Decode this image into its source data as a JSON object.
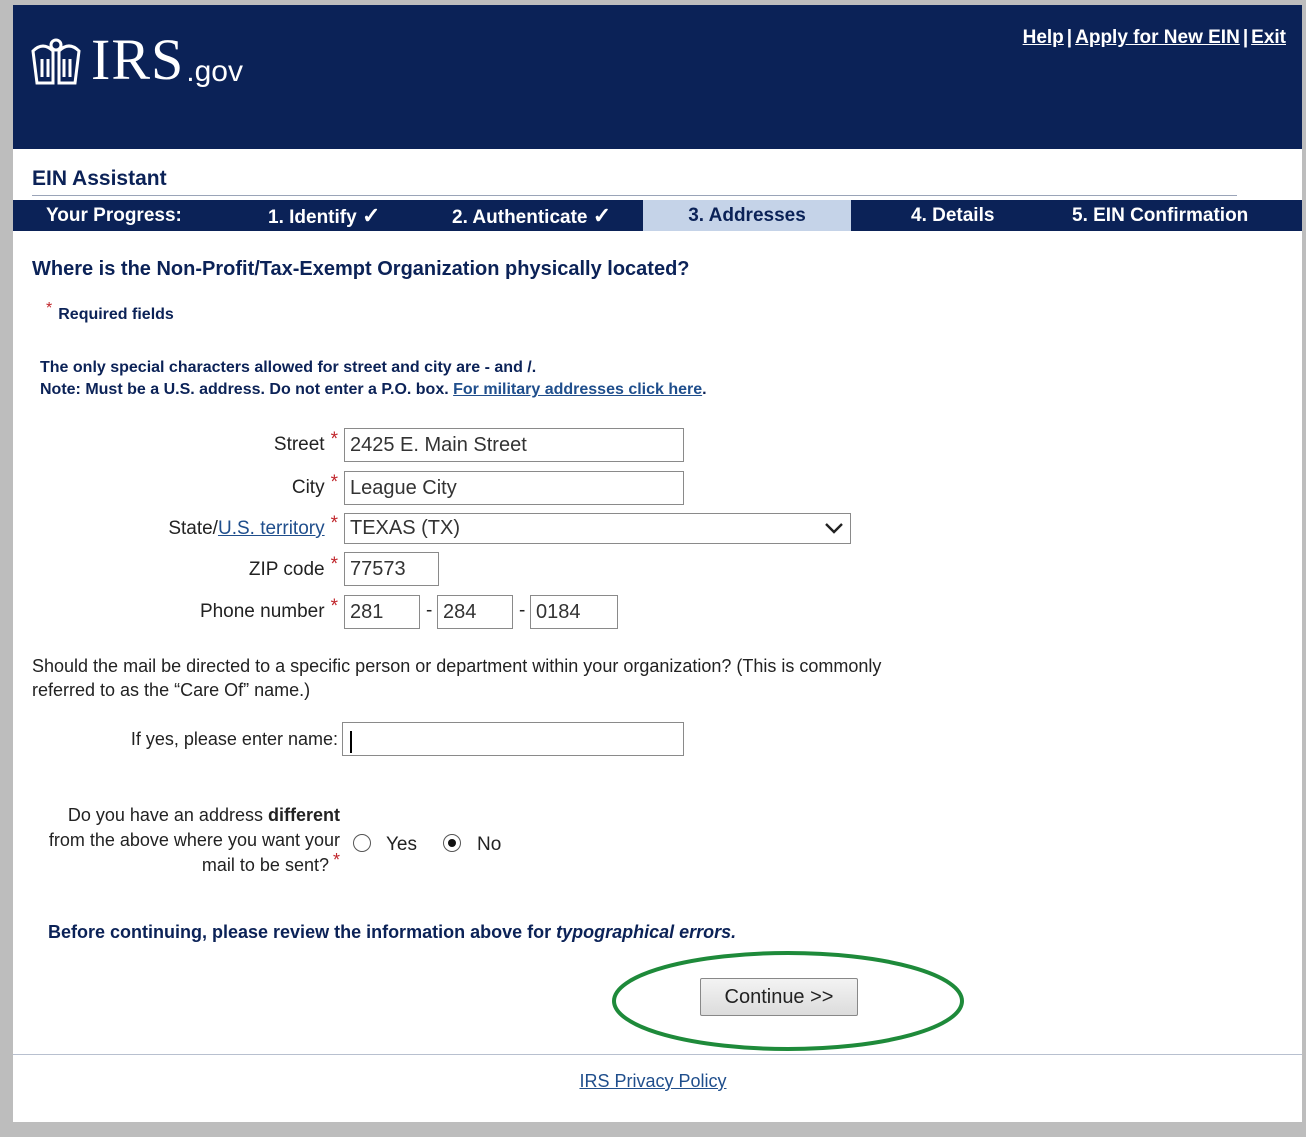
{
  "header": {
    "logo_text": "IRS",
    "logo_suffix": ".gov",
    "links": [
      "Help",
      "Apply for New EIN",
      "Exit"
    ],
    "separator": "|"
  },
  "assistant_title": "EIN Assistant",
  "progress": {
    "label": "Your Progress:",
    "steps": [
      {
        "label": "1. Identify",
        "status": "complete"
      },
      {
        "label": "2. Authenticate",
        "status": "complete"
      },
      {
        "label": "3. Addresses",
        "status": "current"
      },
      {
        "label": "4. Details",
        "status": "pending"
      },
      {
        "label": "5. EIN Confirmation",
        "status": "pending"
      }
    ],
    "check_glyph": "✓"
  },
  "question": "Where is the Non-Profit/Tax-Exempt Organization physically located?",
  "required_note": "Required fields",
  "required_marker": "*",
  "notes": {
    "line1": "The only special characters allowed for street and city are - and /.",
    "line2": "Note: Must be a U.S. address. Do not enter a P.O. box.",
    "military_link": "For military addresses click here",
    "line2_end": "."
  },
  "form": {
    "street": {
      "label": "Street",
      "value": "2425 E. Main Street"
    },
    "city": {
      "label": "City",
      "value": "League City"
    },
    "state": {
      "label_prefix": "State/",
      "label_link": "U.S. territory",
      "value": "TEXAS (TX)"
    },
    "zip": {
      "label": "ZIP code",
      "value": "77573"
    },
    "phone": {
      "label": "Phone number",
      "area": "281",
      "prefix": "284",
      "line": "0184",
      "dash": "-"
    }
  },
  "care_of": {
    "question": "Should the mail be directed to a specific person or department within your organization? (This is commonly referred to as the “Care Of” name.)",
    "label": "If yes, please enter name:",
    "value": ""
  },
  "different_address": {
    "q_part1": "Do you have an address",
    "q_bold": "different",
    "q_part2": "from the above where you want your mail to be sent?",
    "options": [
      "Yes",
      "No"
    ],
    "selected": "No"
  },
  "review": {
    "text": "Before continuing, please review the information above for",
    "emphasis": "typographical errors."
  },
  "continue_label": "Continue >>",
  "footer_link": "IRS Privacy Policy",
  "colors": {
    "navy": "#0b2257",
    "current_step": "#c5d3e8",
    "required": "#c0252b",
    "highlight": "#1e8a3a"
  }
}
